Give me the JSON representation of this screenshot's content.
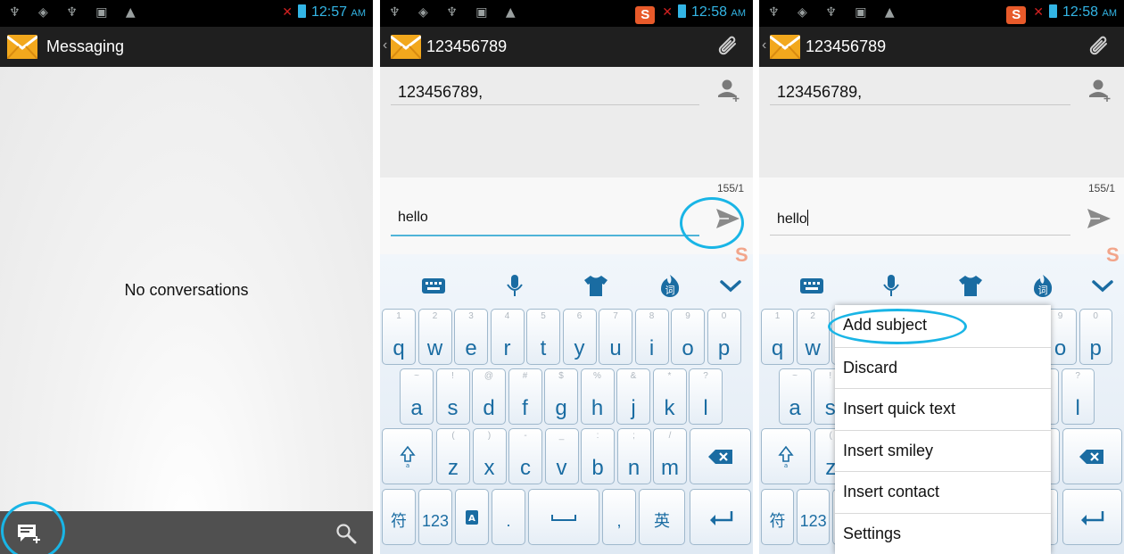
{
  "panel1": {
    "status_time": "12:57",
    "status_ampm": "AM",
    "app_title": "Messaging",
    "empty_text": "No conversations"
  },
  "panel2": {
    "status_time": "12:58",
    "status_ampm": "AM",
    "title": "123456789",
    "recipient": "123456789,",
    "counter": "155/1",
    "message": "hello"
  },
  "panel3": {
    "status_time": "12:58",
    "status_ampm": "AM",
    "title": "123456789",
    "recipient": "123456789,",
    "counter": "155/1",
    "message": "hello",
    "menu": [
      "Add subject",
      "Discard",
      "Insert quick text",
      "Insert smiley",
      "Insert contact",
      "Settings"
    ]
  },
  "status_icons": "♆ ◈ ♆ ▣ ▲",
  "keyboard": {
    "row1": [
      [
        "1",
        "q"
      ],
      [
        "2",
        "w"
      ],
      [
        "3",
        "e"
      ],
      [
        "4",
        "r"
      ],
      [
        "5",
        "t"
      ],
      [
        "6",
        "y"
      ],
      [
        "7",
        "u"
      ],
      [
        "8",
        "i"
      ],
      [
        "9",
        "o"
      ],
      [
        "0",
        "p"
      ]
    ],
    "row2": [
      [
        "~",
        "a"
      ],
      [
        "!",
        "s"
      ],
      [
        "@",
        "d"
      ],
      [
        "#",
        "f"
      ],
      [
        "$",
        "g"
      ],
      [
        "%",
        "h"
      ],
      [
        "&",
        "j"
      ],
      [
        "*",
        "k"
      ],
      [
        "?",
        "l"
      ]
    ],
    "row3": [
      [
        "(",
        "z"
      ],
      [
        ")",
        "x"
      ],
      [
        "-",
        "c"
      ],
      [
        "_",
        "v"
      ],
      [
        ":",
        "b"
      ],
      [
        ";",
        "n"
      ],
      [
        "/",
        "m"
      ]
    ],
    "symbol_key": "符",
    "numbers_key": "123",
    "period_key": ".",
    "comma_key": ",",
    "lang_key": "英",
    "ci_key": "词"
  },
  "colors": {
    "accent": "#33b5e5",
    "highlight": "#19b5e6",
    "key_text": "#1a6ca2"
  }
}
